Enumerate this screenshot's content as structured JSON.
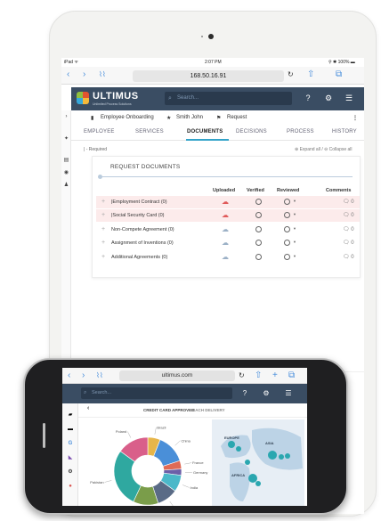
{
  "tablet": {
    "status": {
      "carrier": "iPad ᯤ",
      "time": "2:07 PM",
      "battery": "⚲ ✱ 100% ▬"
    },
    "browser": {
      "url": "168.50.16.91",
      "back": "‹",
      "forward": "›",
      "bookmarks": "⌇⌇",
      "reload": "↻",
      "share": "⇧",
      "tabs": "⧉"
    },
    "app": {
      "brand": "ULTIMUS",
      "brand_sub": "Unlimited Process Solutions",
      "search_placeholder": "Search...",
      "help_icon": "?",
      "settings_icon": "⚙",
      "menu_icon": "☰"
    },
    "breadcrumb": {
      "workflow": "Employee Onboarding",
      "person": "Smith John",
      "type": "Request",
      "more": "⋮"
    },
    "tabs": [
      "EMPLOYEE",
      "SERVICES",
      "DOCUMENTS",
      "DECISIONS",
      "PROCESS",
      "HISTORY"
    ],
    "active_tab": "DOCUMENTS",
    "required_note": "| - Required",
    "expand_collapse": "⊕ Expand all / ⊖ Collapse all",
    "documents": {
      "title": "REQUEST DOCUMENTS",
      "columns": {
        "uploaded": "Uploaded",
        "verified": "Verified",
        "reviewed": "Reviewed",
        "comments": "Comments"
      },
      "rows": [
        {
          "label": "|Employment Contract",
          "count": "(0)",
          "required": true,
          "comments": "0"
        },
        {
          "label": "|Social Security Card",
          "count": "(0)",
          "required": true,
          "comments": "0"
        },
        {
          "label": "Non-Compete Agreement",
          "count": "(0)",
          "required": false,
          "comments": "0"
        },
        {
          "label": "Assignment of Inventions",
          "count": "(0)",
          "required": false,
          "comments": "0"
        },
        {
          "label": "Additional Agreements",
          "count": "(0)",
          "required": false,
          "comments": "0"
        }
      ]
    }
  },
  "phone": {
    "browser": {
      "url": "ultimus.com",
      "back": "‹",
      "forward": "›",
      "bookmarks": "⌇⌇",
      "reload": "↻",
      "share": "⇧",
      "add": "+",
      "tabs": "⧉"
    },
    "search_placeholder": "Search...",
    "tabs": [
      "CREDIT CARD APPROVED",
      "RACH DELIVERY"
    ],
    "back": "‹",
    "chart_data": {
      "type": "pie",
      "categories": [
        "Brazil",
        "China",
        "France",
        "Germany",
        "India",
        "Mexico",
        "Norway",
        "Pakistan",
        "Poland"
      ],
      "values": [
        6,
        14,
        4,
        3,
        8,
        10,
        12,
        28,
        15
      ],
      "colors": [
        "#e7b64a",
        "#4a8fd8",
        "#e06a55",
        "#6c5fa8",
        "#4bb8c9",
        "#5a6b86",
        "#7a9d4a",
        "#2fa8a0",
        "#d95f8a"
      ]
    },
    "map_labels": {
      "europe": "EUROPE",
      "asia": "ASIA",
      "africa": "AFRICA"
    }
  }
}
